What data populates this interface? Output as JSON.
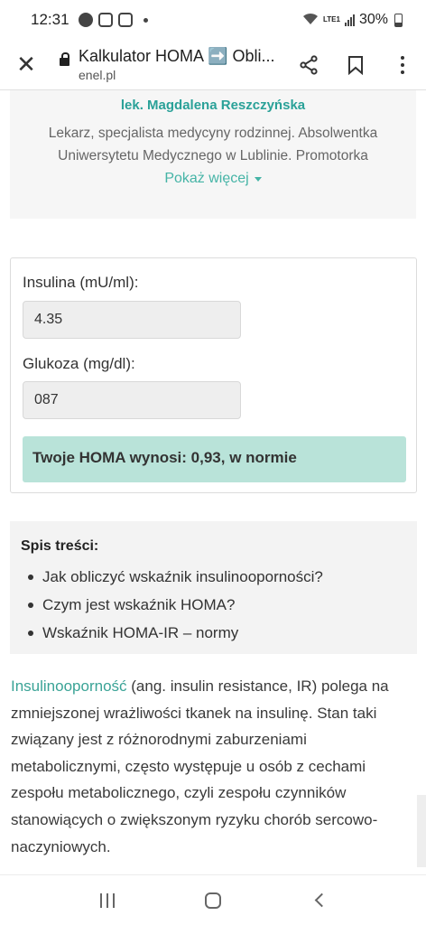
{
  "status": {
    "time": "12:31",
    "battery": "30%",
    "network": "LTE1"
  },
  "browser": {
    "title": "Kalkulator HOMA ➡️ Obli...",
    "domain": "enel.pl"
  },
  "author": {
    "name": "lek. Magdalena Reszczyńska",
    "description": "Lekarz, specjalista medycyny rodzinnej. Absolwentka Uniwersytetu Medycznego w Lublinie. Promotorka",
    "show_more": "Pokaż więcej"
  },
  "calculator": {
    "insulin_label": "Insulina (mU/ml):",
    "insulin_value": "4.35",
    "glucose_label": "Glukoza (mg/dl):",
    "glucose_value": "087",
    "result": "Twoje HOMA wynosi: 0,93, w normie"
  },
  "toc": {
    "title": "Spis treści:",
    "items": [
      "Jak obliczyć wskaźnik insulinooporności?",
      "Czym jest wskaźnik HOMA?",
      "Wskaźnik HOMA-IR – normy"
    ]
  },
  "article": {
    "link_text": "Insulinooporność",
    "body": " (ang. insulin resistance, IR) polega na zmniejszonej wrażliwości tkanek na insulinę. Stan taki związany jest z różnorodnymi zaburzeniami metabolicznymi, często występuje u osób z cechami zespołu metabolicznego, czyli zespołu czynników stanowiących o zwiększonym ryzyku chorób sercowo-naczyniowych."
  },
  "icons": {
    "close": "close-icon",
    "lock": "lock-icon",
    "share": "share-icon",
    "bookmark": "bookmark-icon",
    "menu": "more-vert-icon"
  },
  "colors": {
    "accent": "#2aa198",
    "result_bg": "#b9e3d9"
  }
}
